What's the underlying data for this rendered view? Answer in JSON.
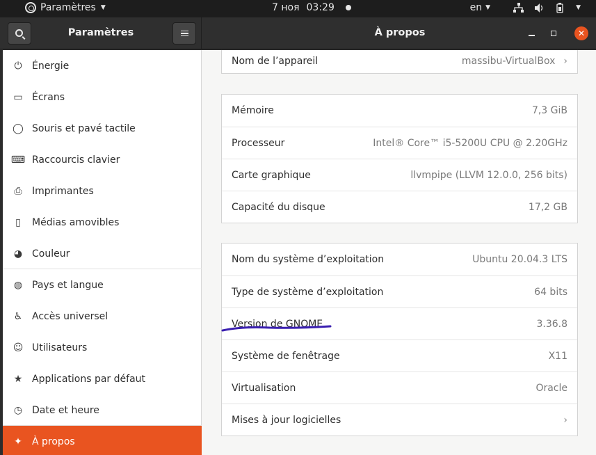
{
  "topbar": {
    "app_menu_label": "Paramètres",
    "date": "7 ноя",
    "time": "03:29",
    "language": "en"
  },
  "headerbar": {
    "sidebar_title": "Paramètres",
    "panel_title": "À propos"
  },
  "sidebar": {
    "items": [
      {
        "label": "Énergie",
        "icon": "power-icon"
      },
      {
        "label": "Écrans",
        "icon": "display-icon"
      },
      {
        "label": "Souris et pavé tactile",
        "icon": "mouse-icon"
      },
      {
        "label": "Raccourcis clavier",
        "icon": "keyboard-icon"
      },
      {
        "label": "Imprimantes",
        "icon": "printer-icon"
      },
      {
        "label": "Médias amovibles",
        "icon": "removable-media-icon"
      },
      {
        "label": "Couleur",
        "icon": "color-icon"
      },
      {
        "label": "Pays et langue",
        "icon": "globe-icon"
      },
      {
        "label": "Accès universel",
        "icon": "accessibility-icon"
      },
      {
        "label": "Utilisateurs",
        "icon": "users-icon"
      },
      {
        "label": "Applications par défaut",
        "icon": "star-icon"
      },
      {
        "label": "Date et heure",
        "icon": "clock-icon"
      },
      {
        "label": "À propos",
        "icon": "sparkle-icon"
      }
    ],
    "active_index": 12
  },
  "about": {
    "device": {
      "label": "Nom de l’appareil",
      "value": "massibu-VirtualBox"
    },
    "hardware": [
      {
        "label": "Mémoire",
        "value": "7,3 GiB"
      },
      {
        "label": "Processeur",
        "value": "Intel® Core™ i5-5200U CPU @ 2.20GHz"
      },
      {
        "label": "Carte graphique",
        "value": "llvmpipe (LLVM 12.0.0, 256 bits)"
      },
      {
        "label": "Capacité du disque",
        "value": "17,2 GB"
      }
    ],
    "os": [
      {
        "label": "Nom du système d’exploitation",
        "value": "Ubuntu 20.04.3 LTS"
      },
      {
        "label": "Type de système d’exploitation",
        "value": "64 bits"
      },
      {
        "label": "Version de GNOME",
        "value": "3.36.8"
      },
      {
        "label": "Système de fenêtrage",
        "value": "X11"
      },
      {
        "label": "Virtualisation",
        "value": "Oracle"
      },
      {
        "label": "Mises à jour logicielles",
        "value": ""
      }
    ]
  },
  "colors": {
    "accent": "#e95420",
    "annotation": "#3a1fb0"
  }
}
